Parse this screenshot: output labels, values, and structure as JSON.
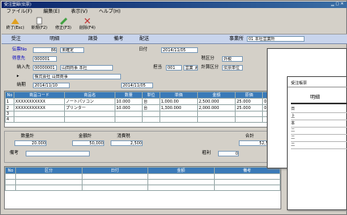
{
  "window": {
    "title": "受注登録(伝票)"
  },
  "menu": [
    "ファイル(F)",
    "編集(E)",
    "表示(V)",
    "ヘルプ(H)"
  ],
  "toolbar": [
    {
      "label": "終了(Esc)",
      "icon": "exit-icon"
    },
    {
      "label": "新規(F2)",
      "icon": "new-icon"
    },
    {
      "label": "修正(F3)",
      "icon": "edit-icon"
    },
    {
      "label": "削除(F4)",
      "icon": "delete-icon"
    }
  ],
  "ribbon": {
    "tabs": [
      "受注",
      "明細",
      "諸掛",
      "備考",
      "配送"
    ],
    "code_label": "事業所",
    "code_value": "01 本社営業所"
  },
  "header": {
    "doc_no_label": "伝票No",
    "doc_no": "86",
    "status": "未確定",
    "date_label": "日付",
    "date": "2014/11/05",
    "customer_label": "得意先",
    "customer_code": "000001",
    "customer_name": "株式会社 山田商事",
    "dest_label": "納入先",
    "dest_code": "00000001",
    "dest_name": "山田商事 本社",
    "staff_label": "担当",
    "staff_code": "001",
    "staff_name": "営業 太郎",
    "delivery_label": "納期",
    "delivery_date": "2014/11/10",
    "tax_label": "税区分",
    "tax_value": "外税",
    "calc_label": "計算区分",
    "calc_value": "伝票単位"
  },
  "lines": {
    "columns": [
      "No",
      "商品コード",
      "商品名",
      "数量",
      "単位",
      "単価",
      "金額",
      "原価",
      "粗利"
    ],
    "rows": [
      {
        "no": "1",
        "code": "XXXXXXXXXXX",
        "name": "ノートパソコン",
        "qty": "10.000",
        "unit": "台",
        "price": "1,000.00",
        "amount": "2,500.000",
        "cost": "25.000",
        "profit": "0"
      },
      {
        "no": "2",
        "code": "XXXXXXXXXXX",
        "name": "プリンター",
        "qty": "10.000",
        "unit": "台",
        "price": "1,300.000",
        "amount": "2,000.000",
        "cost": "25.000",
        "profit": "0"
      },
      {
        "no": "3",
        "code": "",
        "name": "",
        "qty": "",
        "unit": "",
        "price": "",
        "amount": "",
        "cost": "",
        "profit": ""
      },
      {
        "no": "4",
        "code": "",
        "name": "",
        "qty": "",
        "unit": "",
        "price": "",
        "amount": "",
        "cost": "",
        "profit": ""
      },
      {
        "no": "5",
        "code": "",
        "name": "",
        "qty": "",
        "unit": "",
        "price": "",
        "amount": "",
        "cost": "",
        "profit": ""
      }
    ]
  },
  "totals": {
    "qty_label": "数量計",
    "qty": "20.000",
    "amount_label": "金額計",
    "amount": "50,000",
    "tax_label": "消費税",
    "tax": "2,500",
    "total_label": "合計",
    "total": "52,500",
    "note_label": "備考",
    "profit_label": "粗利",
    "profit": "0"
  },
  "subgrid": {
    "columns": [
      "No",
      "区分",
      "日付",
      "金額",
      "備考"
    ],
    "rows": 3
  },
  "dialogs": {
    "back_title": "",
    "front_title": "受注帳票",
    "front_heading": "明細",
    "front_rows": [
      "日",
      "上",
      "本",
      "二",
      "二",
      "二"
    ]
  }
}
